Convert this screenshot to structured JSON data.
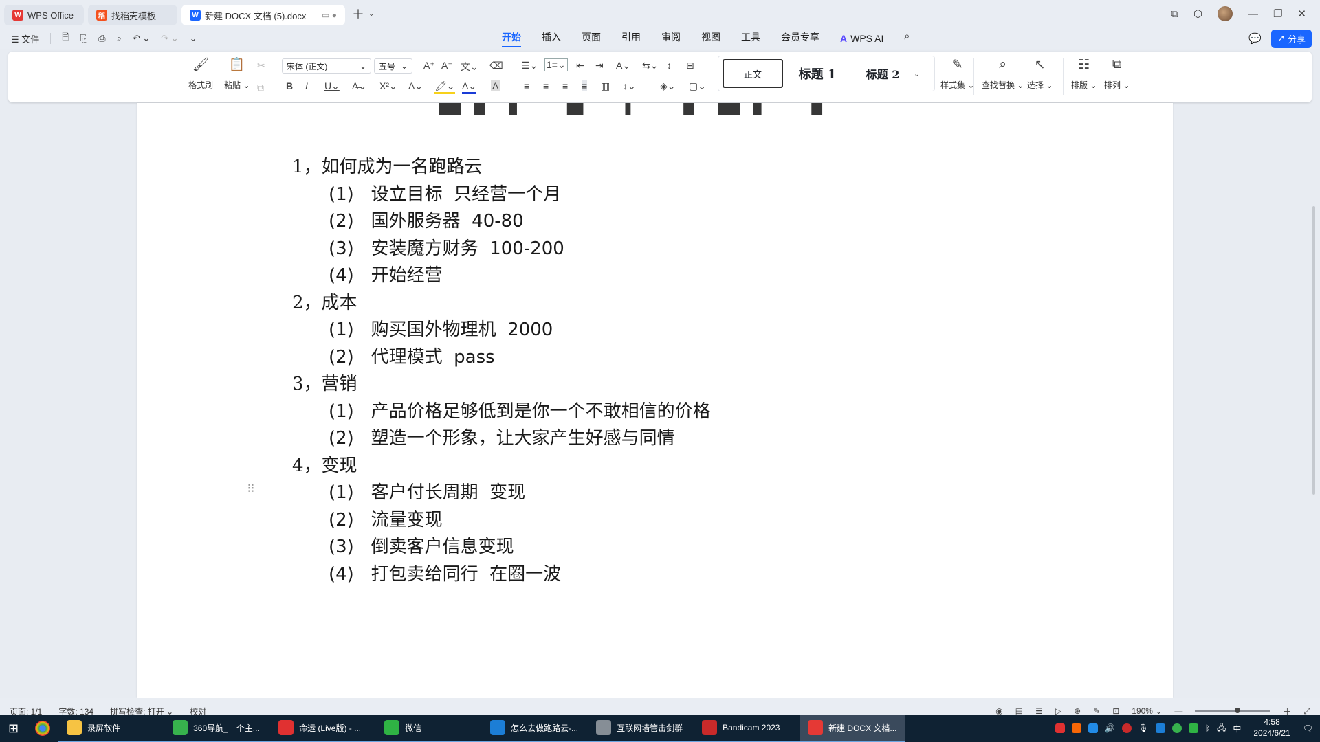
{
  "tabs": [
    {
      "label": "WPS Office",
      "logo": "W",
      "color": "#e53935"
    },
    {
      "label": "找稻壳模板",
      "logo": "稻",
      "color": "#f4511e"
    },
    {
      "label": "新建 DOCX 文档 (5).docx",
      "logo": "W",
      "color": "#1a66ff"
    }
  ],
  "menubar": {
    "file_label": "文件",
    "menus": [
      "开始",
      "插入",
      "页面",
      "引用",
      "审阅",
      "视图",
      "工具",
      "会员专享"
    ],
    "wps_ai": "WPS AI",
    "share": "分享"
  },
  "ribbon": {
    "format_painter": "格式刷",
    "paste": "粘贴",
    "font_name": "宋体 (正文)",
    "font_size": "五号",
    "style_normal": "正文",
    "style_h1": "标题 1",
    "style_h2": "标题 2",
    "style_set": "样式集",
    "find_replace": "查找替换",
    "select": "选择",
    "layout": "排版",
    "arrange": "排列"
  },
  "document": {
    "lines": [
      {
        "text": "1，如何成为一名跑路云",
        "level": 1
      },
      {
        "text": "(1)   设立目标  只经营一个月",
        "level": 2
      },
      {
        "text": "(2)   国外服务器  40-80",
        "level": 2
      },
      {
        "text": "(3)   安装魔方财务  100-200",
        "level": 2
      },
      {
        "text": "(4)   开始经营",
        "level": 2
      },
      {
        "text": "2，成本",
        "level": 1
      },
      {
        "text": "(1)   购买国外物理机  2000",
        "level": 2
      },
      {
        "text": "(2)   代理模式  pass",
        "level": 2
      },
      {
        "text": "3，营销",
        "level": 1
      },
      {
        "text": "(1)   产品价格足够低到是你一个不敢相信的价格",
        "level": 2
      },
      {
        "text": "(2)   塑造一个形象，让大家产生好感与同情",
        "level": 2
      },
      {
        "text": "4，变现",
        "level": 1
      },
      {
        "text": "(1)   客户付长周期  变现",
        "level": 2
      },
      {
        "text": "(2)   流量变现",
        "level": 2
      },
      {
        "text": "(3)   倒卖客户信息变现",
        "level": 2
      },
      {
        "text": "(4)   打包卖给同行  在圈一波",
        "level": 2
      }
    ]
  },
  "status": {
    "page": "页面: 1/1",
    "words": "字数: 134",
    "spell": "拼写检查: 打开",
    "proof": "校对",
    "zoom": "190%"
  },
  "taskbar": {
    "apps": [
      {
        "label": "录屏软件",
        "color": "#f6c343"
      },
      {
        "label": "360导航_一个主...",
        "color": "#37b24d"
      },
      {
        "label": "命运 (Live版) - ...",
        "color": "#e03131"
      },
      {
        "label": "微信",
        "color": "#2fb344"
      },
      {
        "label": "怎么去做跑路云-...",
        "color": "#1c7ed6"
      },
      {
        "label": "互联网墙管击剑群",
        "color": "#868e96"
      },
      {
        "label": "Bandicam 2023",
        "color": "#c92a2a"
      },
      {
        "label": "新建 DOCX 文档...",
        "color": "#e53935"
      }
    ],
    "time": "4:58",
    "date": "2024/6/21",
    "ime": "中"
  }
}
